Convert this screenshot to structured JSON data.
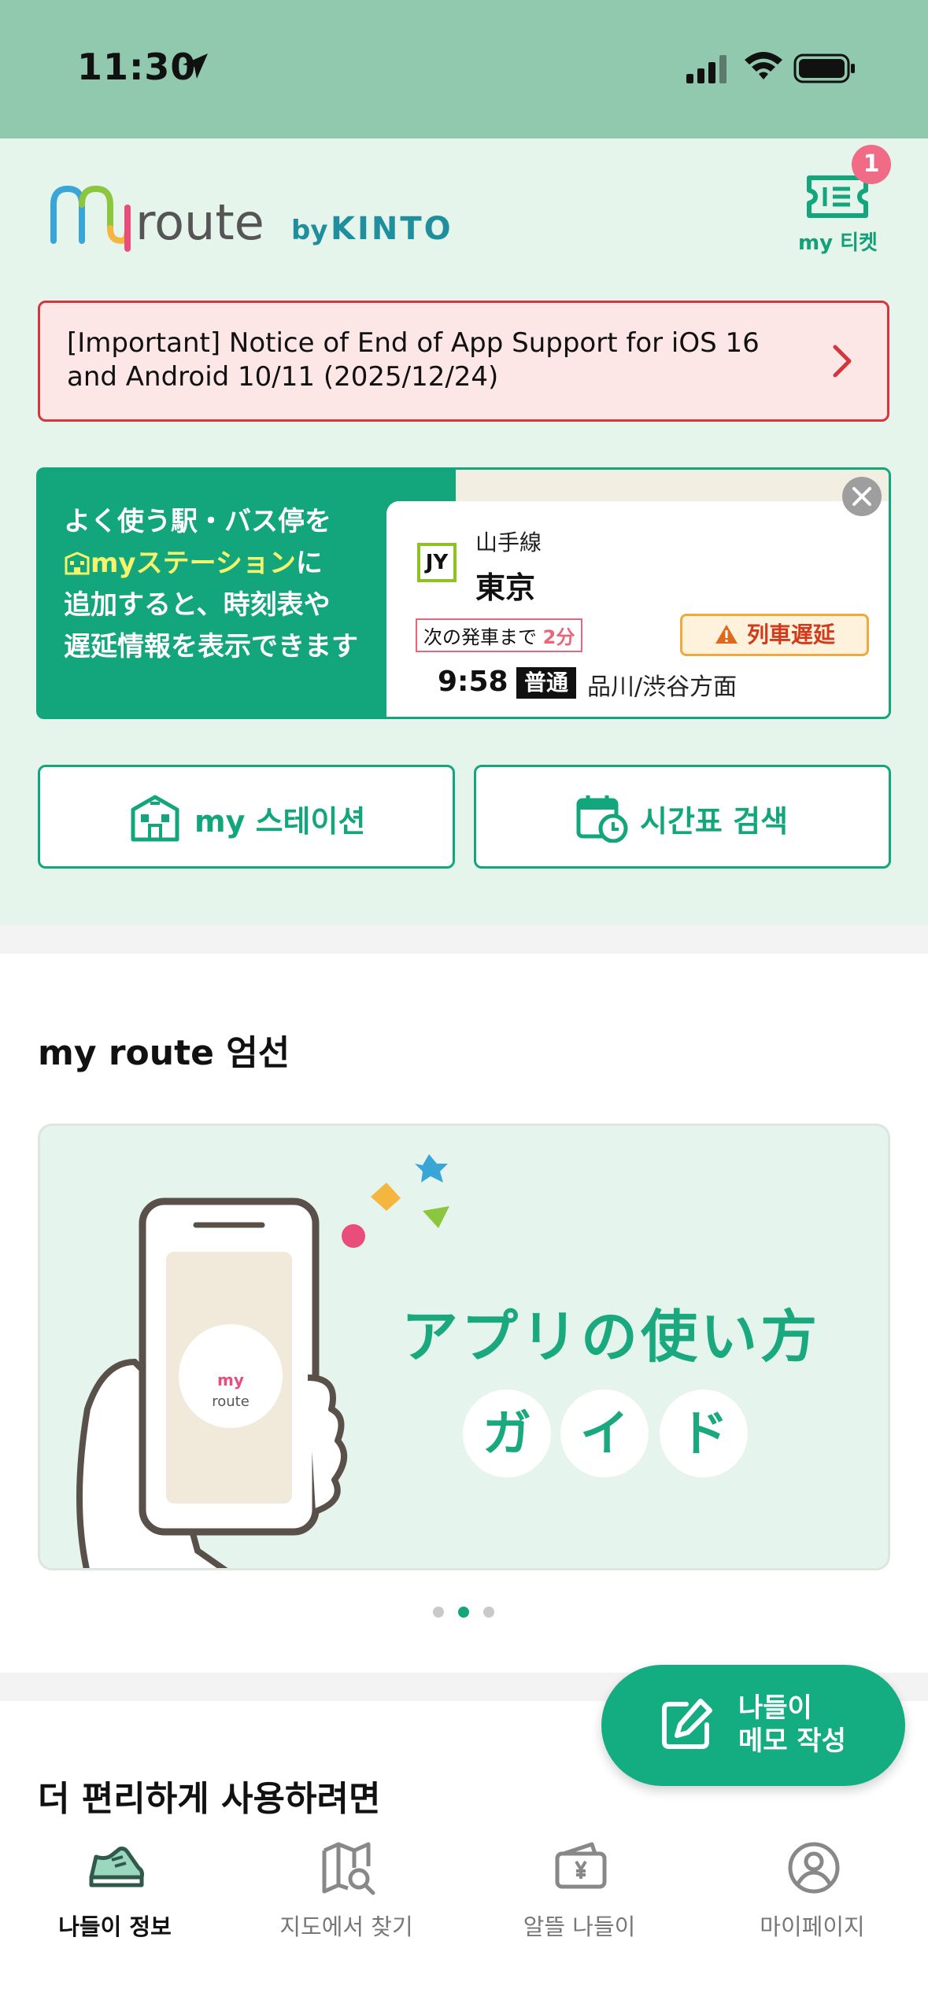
{
  "status_bar": {
    "time": "11:30"
  },
  "header": {
    "logo_text": "my route",
    "logo_by": "by KINTO",
    "ticket_badge": "1",
    "ticket_label": "my 티켓"
  },
  "notice": {
    "text": "[Important] Notice of End of App Support for iOS 16 and Android 10/11 (2025/12/24)"
  },
  "promo": {
    "line1": "よく使う駅・バス停を",
    "highlight": "myステーション",
    "line2_suffix": "に",
    "line3": "追加すると、時刻表や",
    "line4": "遅延情報を表示できます",
    "sample": {
      "line_code": "JY",
      "line_name": "山手線",
      "station": "東京",
      "next_label": "次の発車まで",
      "next_value": "2分",
      "delay": "列車遅延",
      "time": "9:58",
      "train_type": "普通",
      "destination": "品川/渋谷方面"
    }
  },
  "actions": {
    "my_station": "my 스테이션",
    "timetable": "시간표 검색"
  },
  "picks": {
    "title": "my route 엄선",
    "banner_title": "アプリの使い方",
    "banner_guide": [
      "ガ",
      "イ",
      "ド"
    ],
    "phone_logo": "route",
    "active_page": 2,
    "page_count": 3
  },
  "fab": {
    "line1": "나들이",
    "line2": "메모 작성"
  },
  "more": {
    "title": "더 편리하게 사용하려면"
  },
  "tabs": [
    {
      "label": "나들이 정보",
      "icon": "sneaker-icon",
      "active": true
    },
    {
      "label": "지도에서 찾기",
      "icon": "map-search-icon",
      "active": false
    },
    {
      "label": "알뜰 나들이",
      "icon": "wallet-yen-icon",
      "active": false
    },
    {
      "label": "마이페이지",
      "icon": "user-circle-icon",
      "active": false
    }
  ],
  "colors": {
    "accent": "#13a57c",
    "header_bg": "#e5f5ec",
    "status_bg": "#90c9ae",
    "notice_border": "#d2373d",
    "notice_bg": "#fde6e6",
    "badge": "#ef6b86"
  }
}
